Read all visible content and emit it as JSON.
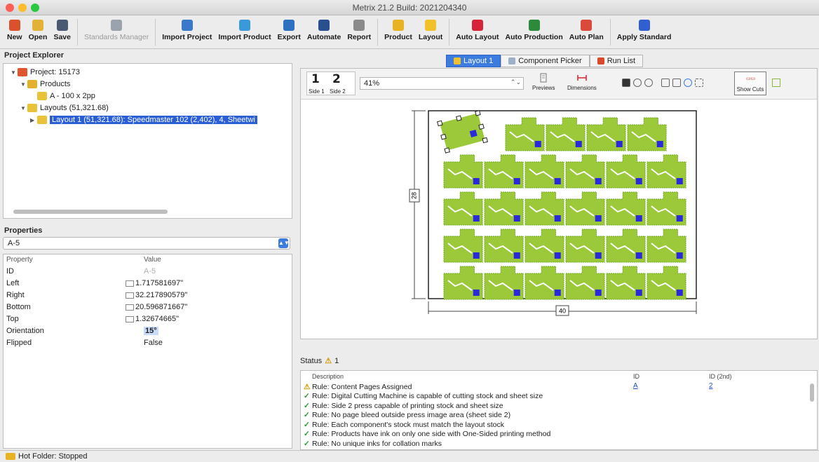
{
  "window": {
    "title": "Metrix 21.2 Build: 2021204340",
    "lights": [
      "#fc5f57",
      "#fdbc2e",
      "#28c840"
    ]
  },
  "toolbar": {
    "buttons": [
      {
        "label": "New",
        "icon": "new-icon",
        "color": "#d9522b"
      },
      {
        "label": "Open",
        "icon": "open-icon",
        "color": "#e2b13a"
      },
      {
        "label": "Save",
        "icon": "save-icon",
        "color": "#4a5a73"
      },
      {
        "label": "Standards Manager",
        "icon": "standards-manager-icon",
        "color": "#9aa3ad",
        "disabled": true
      },
      {
        "label": "Import Project",
        "icon": "import-project-icon",
        "color": "#3a78c9"
      },
      {
        "label": "Import Product",
        "icon": "import-product-icon",
        "color": "#3a9ad9"
      },
      {
        "label": "Export",
        "icon": "export-icon",
        "color": "#2e6fbf"
      },
      {
        "label": "Automate",
        "icon": "automate-icon",
        "color": "#2a4f8f"
      },
      {
        "label": "Report",
        "icon": "report-icon",
        "color": "#8a8a8a"
      },
      {
        "label": "Product",
        "icon": "product-icon",
        "color": "#e8b323"
      },
      {
        "label": "Layout",
        "icon": "layout-icon",
        "color": "#f0c12b"
      },
      {
        "label": "Auto Layout",
        "icon": "auto-layout-icon",
        "color": "#d6233a"
      },
      {
        "label": "Auto Production",
        "icon": "auto-production-icon",
        "color": "#2c8a3a"
      },
      {
        "label": "Auto Plan",
        "icon": "auto-plan-icon",
        "color": "#d94a3a"
      },
      {
        "label": "Apply Standard",
        "icon": "apply-standard-icon",
        "color": "#2f5fd0"
      }
    ]
  },
  "explorer": {
    "title": "Project Explorer",
    "tree": [
      {
        "label": "Project: 15173",
        "icon": "project-icon",
        "color": "#e0562e",
        "depth": 0,
        "expanded": true
      },
      {
        "label": "Products",
        "icon": "products-folder-icon",
        "color": "#e4b02b",
        "depth": 1,
        "expanded": true
      },
      {
        "label": "A - 100 x 2pp",
        "icon": "product-item-icon",
        "color": "#e8c33a",
        "depth": 2
      },
      {
        "label": "Layouts (51,321.68)",
        "icon": "layouts-folder-icon",
        "color": "#e8c33a",
        "depth": 1,
        "expanded": true
      },
      {
        "label": "Layout 1 (51,321.68): Speedmaster 102 (2,402), 4, Sheetwi",
        "icon": "layout-item-icon",
        "color": "#e8c33a",
        "depth": 2,
        "selected": true
      }
    ]
  },
  "properties": {
    "title": "Properties",
    "selected": "A-5",
    "col_property": "Property",
    "col_value": "Value",
    "rows": [
      {
        "name": "ID",
        "value": "A-5",
        "dim": true
      },
      {
        "name": "Left",
        "value": "1.717581697\"",
        "icon": "left-icon"
      },
      {
        "name": "Right",
        "value": "32.217890579\"",
        "icon": "right-icon"
      },
      {
        "name": "Bottom",
        "value": "20.596871667\"",
        "icon": "bottom-icon"
      },
      {
        "name": "Top",
        "value": "1.32674665\"",
        "icon": "top-icon"
      },
      {
        "name": "Orientation",
        "value": "15°",
        "highlight": true
      },
      {
        "name": "Flipped",
        "value": "False"
      }
    ]
  },
  "tabs": [
    {
      "label": "Layout 1",
      "active": true,
      "color": "#f0c12b"
    },
    {
      "label": "Component Picker",
      "color": "#9cb0c8"
    },
    {
      "label": "Run List",
      "color": "#d94a2a"
    }
  ],
  "layout_bar": {
    "side1": "1",
    "side2": "2",
    "side1_label": "Side 1",
    "side2_label": "Side 2",
    "zoom": "41%",
    "previews": "Previews",
    "dimensions": "Dimensions",
    "show_cuts": "Show Cuts"
  },
  "sheet": {
    "width_label": "40",
    "height_label": "28",
    "piece_color": "#9cc93a",
    "mark_color": "#2a2adb"
  },
  "status": {
    "label": "Status",
    "warn_count": "1",
    "col_description": "Description",
    "col_id": "ID",
    "col_id2": "ID (2nd)",
    "rows": [
      {
        "text": "Rule: Content Pages Assigned",
        "type": "warn",
        "id": "A",
        "id2": "2"
      },
      {
        "text": "Rule: Digital Cutting Machine is capable of cutting stock and sheet size",
        "type": "ok"
      },
      {
        "text": "Rule: Side 2 press capable of printing stock and sheet size",
        "type": "ok"
      },
      {
        "text": "Rule: No page bleed outside press image area (sheet side 2)",
        "type": "ok"
      },
      {
        "text": "Rule: Each component's stock must match the layout stock",
        "type": "ok"
      },
      {
        "text": "Rule: Products have ink on only one side with One-Sided printing method",
        "type": "ok"
      },
      {
        "text": "Rule: No unique inks for collation marks",
        "type": "ok"
      }
    ]
  },
  "footer": {
    "text": "Hot Folder: Stopped"
  }
}
